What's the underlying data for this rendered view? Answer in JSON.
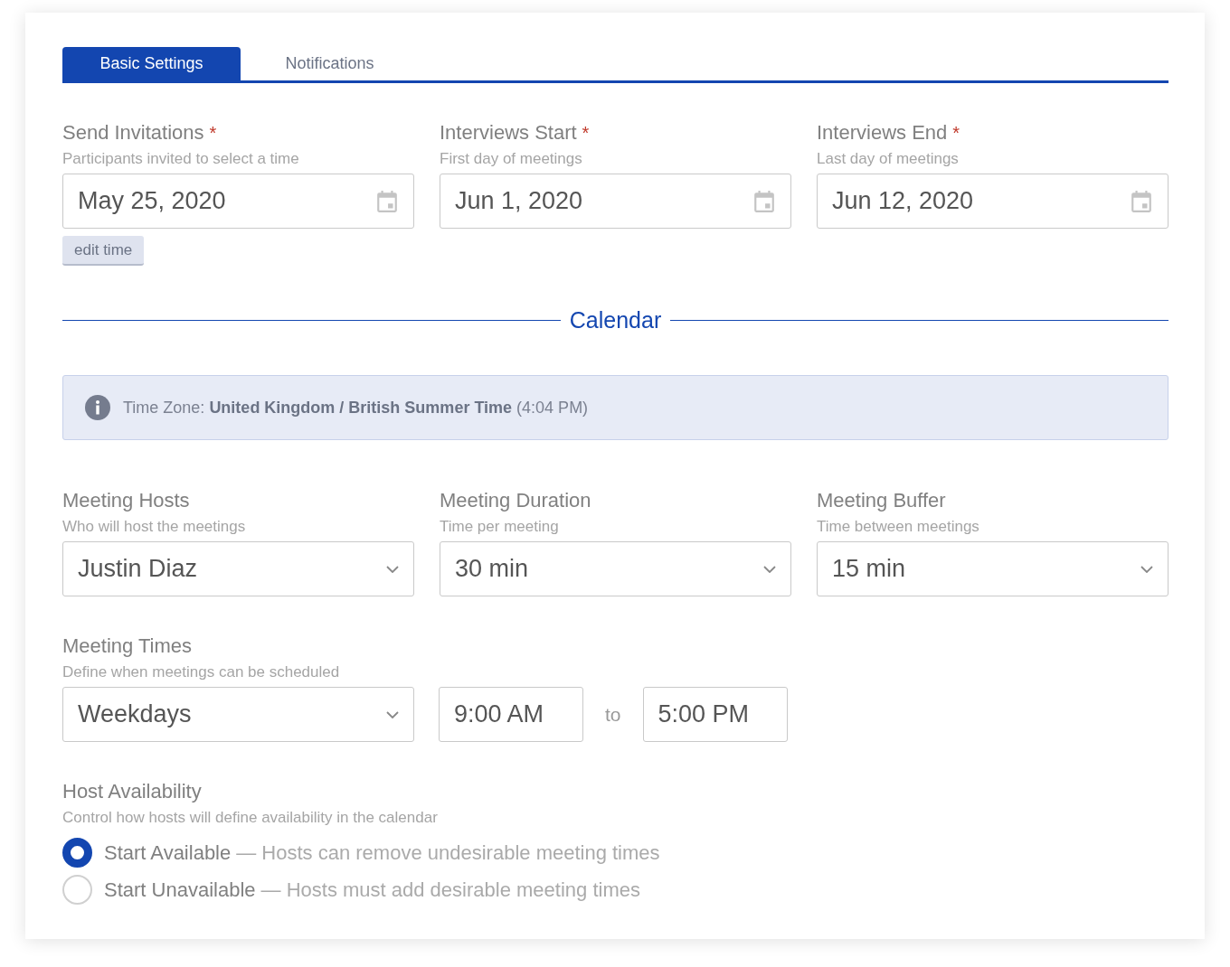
{
  "tabs": [
    {
      "label": "Basic Settings",
      "selected": true
    },
    {
      "label": "Notifications",
      "selected": false
    }
  ],
  "date_fields": [
    {
      "label": "Send Invitations",
      "required": true,
      "hint": "Participants invited to select a time",
      "value": "May 25, 2020"
    },
    {
      "label": "Interviews Start",
      "required": true,
      "hint": "First day of meetings",
      "value": "Jun 1, 2020"
    },
    {
      "label": "Interviews End",
      "required": true,
      "hint": "Last day of meetings",
      "value": "Jun 12, 2020"
    }
  ],
  "required_mark": "*",
  "edit_time_button": "edit time",
  "section_title": "Calendar",
  "time_zone_notice": "Time Zone: **United Kingdom / British Summer Time** (4:04 PM)",
  "select_fields": [
    {
      "label": "Meeting Hosts",
      "hint": "Who will host the meetings",
      "value": "Justin Diaz"
    },
    {
      "label": "Meeting Duration",
      "hint": "Time per meeting",
      "value": "30 min"
    },
    {
      "label": "Meeting Buffer",
      "hint": "Time between meetings",
      "value": "15 min"
    }
  ],
  "meeting_times": {
    "label": "Meeting Times",
    "hint": "Define when meetings can be scheduled",
    "days": "Weekdays",
    "start": "9:00 AM",
    "separator": "to",
    "end": "5:00 PM"
  },
  "host_availability": {
    "label": "Host Availability",
    "hint": "Control how hosts will define availability in the calendar",
    "options": [
      {
        "label": "Start Available",
        "description": "— Hosts can remove undesirable meeting times",
        "selected": true
      },
      {
        "label": "Start Unavailable",
        "description": "— Hosts must add desirable meeting times",
        "selected": false
      }
    ]
  }
}
